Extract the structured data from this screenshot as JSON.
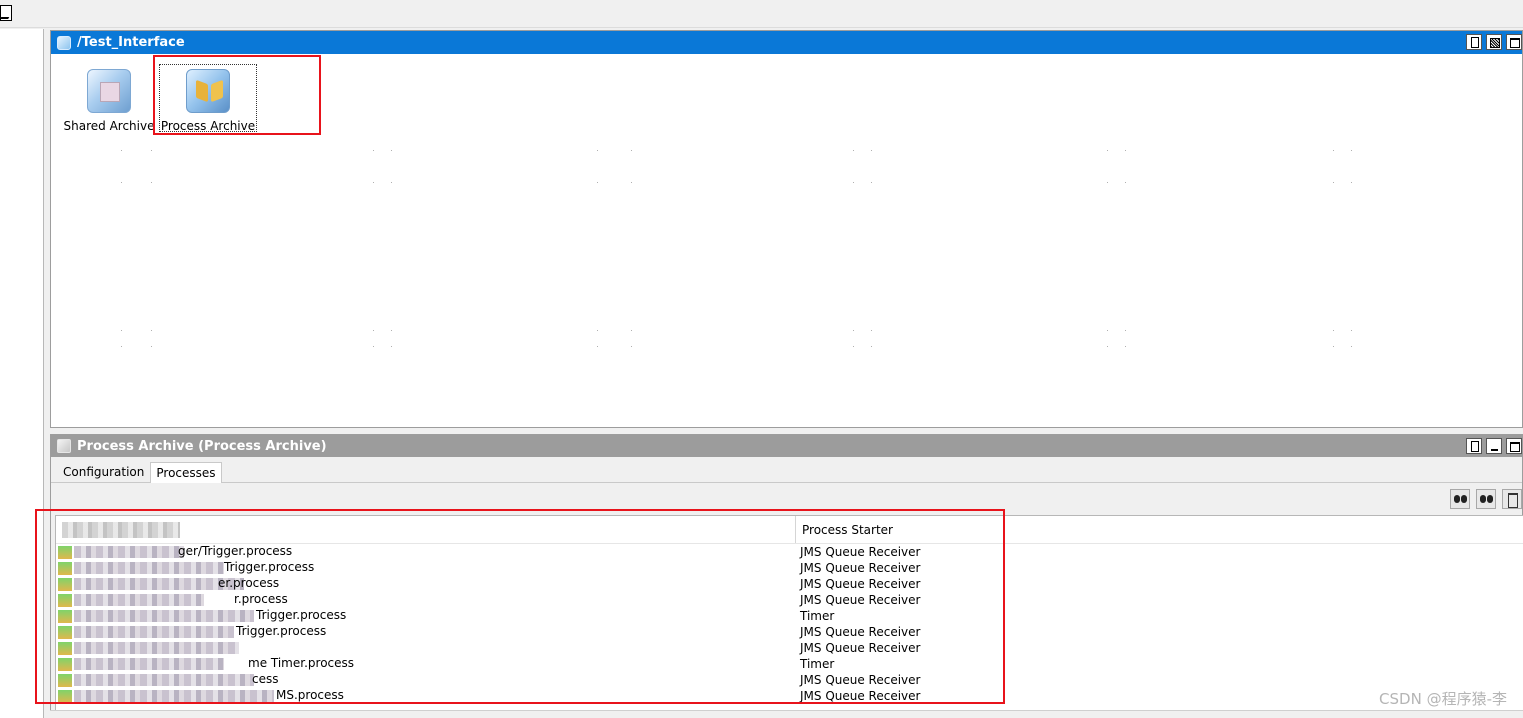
{
  "design": {
    "title": "/Test_Interface",
    "resources": [
      {
        "label": "Shared Archive"
      },
      {
        "label": "Process Archive"
      }
    ]
  },
  "props": {
    "title": "Process Archive (Process Archive)",
    "tabs": [
      "Configuration",
      "Processes"
    ],
    "active_tab": "Processes",
    "table": {
      "columns": [
        "",
        "Process Starter"
      ],
      "rows": [
        {
          "name_suffix": "ger/Trigger.process",
          "starter": "JMS Queue Receiver"
        },
        {
          "name_suffix": "Trigger.process",
          "starter": "JMS Queue Receiver"
        },
        {
          "name_suffix": "er.process",
          "starter": "JMS Queue Receiver"
        },
        {
          "name_suffix": "r.process",
          "starter": "JMS Queue Receiver"
        },
        {
          "name_suffix": "Trigger.process",
          "starter": "Timer"
        },
        {
          "name_suffix": "Trigger.process",
          "starter": "JMS Queue Receiver"
        },
        {
          "name_suffix": "",
          "starter": "JMS Queue Receiver"
        },
        {
          "name_suffix": "me Timer.process",
          "starter": "Timer"
        },
        {
          "name_suffix": "cess",
          "starter": "JMS Queue Receiver"
        },
        {
          "name_suffix": "MS.process",
          "starter": "JMS Queue Receiver"
        }
      ]
    }
  },
  "watermark": "CSDN @程序猿-李",
  "colors": {
    "title_active": "#0a78d7",
    "title_inactive": "#9c9c9c",
    "highlight": "#e8131b"
  },
  "icons": [
    "pencil-icon",
    "shield-icon",
    "shared-archive-icon",
    "process-archive-icon",
    "new-document-icon",
    "restore-icon",
    "maximize-icon",
    "minimize-icon",
    "find-icon",
    "find-next-icon",
    "delete-icon"
  ]
}
